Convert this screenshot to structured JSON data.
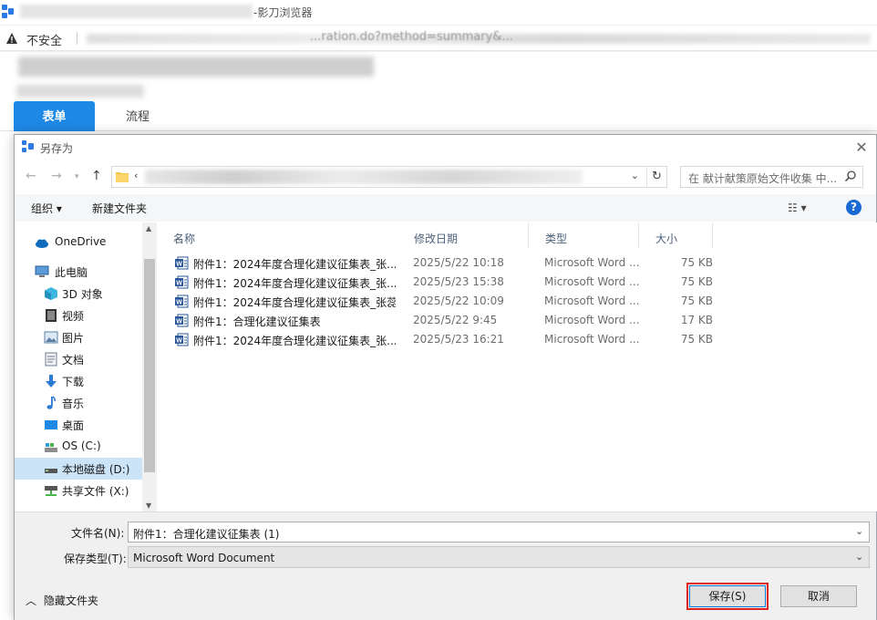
{
  "browser": {
    "title_suffix": "-影刀浏览器",
    "security_label": "不安全",
    "url_visible": "...ration.do?method=summary&..."
  },
  "page": {
    "tabs": [
      {
        "label": "表单",
        "active": true
      },
      {
        "label": "流程",
        "active": false
      }
    ]
  },
  "dialog": {
    "title": "另存为",
    "search_placeholder": "在 献计献策原始文件收集 中...",
    "toolbar": {
      "organize": "组织 ▾",
      "new_folder": "新建文件夹"
    },
    "nav": [
      {
        "label": "OneDrive",
        "icon": "cloud-icon"
      },
      {
        "label": "此电脑",
        "icon": "computer-icon"
      },
      {
        "label": "3D 对象",
        "icon": "cube-icon"
      },
      {
        "label": "视频",
        "icon": "video-icon"
      },
      {
        "label": "图片",
        "icon": "picture-icon"
      },
      {
        "label": "文档",
        "icon": "document-icon"
      },
      {
        "label": "下载",
        "icon": "download-icon"
      },
      {
        "label": "音乐",
        "icon": "music-icon"
      },
      {
        "label": "桌面",
        "icon": "desktop-icon"
      },
      {
        "label": "OS (C:)",
        "icon": "drive-icon"
      },
      {
        "label": "本地磁盘 (D:)",
        "icon": "drive-icon",
        "selected": true
      },
      {
        "label": "共享文件 (X:)",
        "icon": "network-drive-icon"
      }
    ],
    "columns": {
      "name": "名称",
      "date": "修改日期",
      "type": "类型",
      "size": "大小"
    },
    "files": [
      {
        "name": "附件1：2024年度合理化建议征集表_张...",
        "date": "2025/5/22 10:18",
        "type": "Microsoft Word ...",
        "size": "75 KB"
      },
      {
        "name": "附件1：2024年度合理化建议征集表_张...",
        "date": "2025/5/23 15:38",
        "type": "Microsoft Word ...",
        "size": "75 KB"
      },
      {
        "name": "附件1：2024年度合理化建议征集表_张蕊",
        "date": "2025/5/22 10:09",
        "type": "Microsoft Word ...",
        "size": "75 KB"
      },
      {
        "name": "附件1：合理化建议征集表",
        "date": "2025/5/22 9:45",
        "type": "Microsoft Word ...",
        "size": "17 KB"
      },
      {
        "name": "附件1：2024年度合理化建议征集表_张...",
        "date": "2025/5/23 16:21",
        "type": "Microsoft Word ...",
        "size": "75 KB"
      }
    ],
    "filename_label": "文件名(N):",
    "filename_value": "附件1：合理化建议征集表 (1)",
    "filetype_label": "保存类型(T):",
    "filetype_value": "Microsoft Word Document",
    "hide_folders": "隐藏文件夹",
    "save_button": "保存(S)",
    "cancel_button": "取消"
  }
}
